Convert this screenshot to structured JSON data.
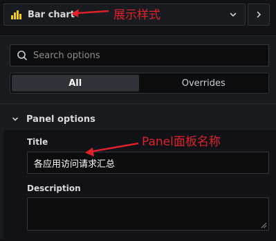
{
  "visualization": {
    "name": "Bar chart",
    "icon": "bar-chart-icon"
  },
  "search": {
    "placeholder": "Search options"
  },
  "tabs": [
    {
      "label": "All",
      "active": true
    },
    {
      "label": "Overrides",
      "active": false
    }
  ],
  "panel_options": {
    "section_title": "Panel options",
    "title_label": "Title",
    "title_value": "各应用访问请求汇总",
    "description_label": "Description",
    "description_value": ""
  },
  "annotations": {
    "viz_note": "展示样式",
    "title_note": "Panel面板名称",
    "color": "#e0202b"
  },
  "colors": {
    "background": "#111217",
    "panel": "#181b1f",
    "accent_bar": "#f2cc0c"
  }
}
